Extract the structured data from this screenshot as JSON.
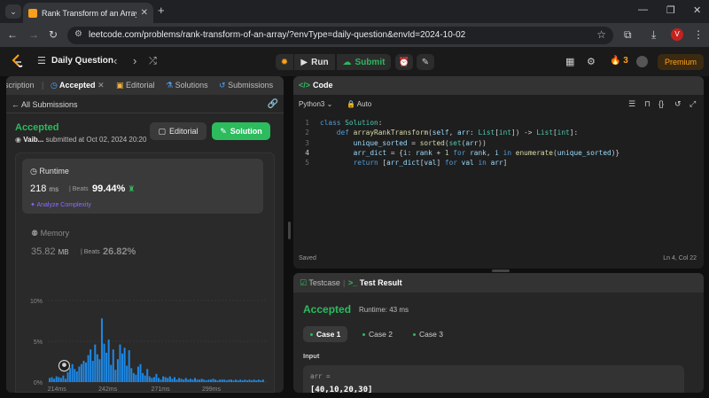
{
  "browser": {
    "tab_title": "Rank Transform of an Array - Le",
    "url": "leetcode.com/problems/rank-transform-of-an-array/?envType=daily-question&envId=2024-10-02",
    "profile_initial": "V"
  },
  "nav": {
    "daily_label": "Daily Question",
    "run_label": "Run",
    "submit_label": "Submit",
    "streak": "3",
    "premium_label": "Premium"
  },
  "left_panel": {
    "tabs": [
      "scription",
      "Accepted",
      "Editorial",
      "Solutions",
      "Submissions"
    ],
    "all_submissions": "All Submissions",
    "status": "Accepted",
    "user": "Vaib...",
    "submitted": "submitted at Oct 02, 2024 20:20",
    "editorial_btn": "Editorial",
    "solution_btn": "Solution",
    "runtime": {
      "label": "Runtime",
      "value": "218",
      "unit": "ms",
      "beats_label": "Beats",
      "beats_value": "99.44%",
      "analyze": "Analyze Complexity"
    },
    "memory": {
      "label": "Memory",
      "value": "35.82",
      "unit": "MB",
      "beats_label": "Beats",
      "beats_value": "26.82%"
    }
  },
  "chart_data": {
    "type": "bar",
    "y_ticks": [
      "10%",
      "5%",
      "0%"
    ],
    "ylim": [
      0,
      10
    ],
    "x_ticks": [
      "214ms",
      "242ms",
      "271ms",
      "299ms"
    ],
    "x_tick_values": [
      214,
      242,
      271,
      299
    ],
    "xlim": [
      209,
      330
    ],
    "x_start": 210,
    "x_step": 1.25,
    "marker_x": 218,
    "values": [
      0.5,
      0.6,
      0.4,
      0.7,
      0.6,
      0.5,
      0.8,
      0.4,
      1.2,
      1.7,
      2.2,
      1.6,
      1.3,
      1.9,
      2.2,
      2.6,
      2.4,
      3.3,
      4.0,
      2.6,
      4.6,
      3.4,
      2.8,
      7.8,
      4.7,
      3.6,
      5.2,
      2.1,
      4.0,
      1.5,
      2.8,
      4.6,
      3.5,
      4.2,
      2.0,
      3.9,
      1.7,
      1.1,
      0.9,
      1.9,
      2.2,
      1.1,
      0.8,
      1.6,
      0.7,
      0.5,
      0.6,
      1.0,
      0.5,
      0.3,
      0.7,
      0.6,
      0.5,
      0.7,
      0.4,
      0.6,
      0.3,
      0.5,
      0.4,
      0.3,
      0.5,
      0.3,
      0.4,
      0.3,
      0.5,
      0.3,
      0.3,
      0.4,
      0.3,
      0.2,
      0.3,
      0.3,
      0.4,
      0.3,
      0.2,
      0.3,
      0.3,
      0.3,
      0.2,
      0.3,
      0.3,
      0.2,
      0.3,
      0.2,
      0.3,
      0.2,
      0.3,
      0.2,
      0.3,
      0.2,
      0.3,
      0.2,
      0.3,
      0.2,
      0.3
    ]
  },
  "code_panel": {
    "title": "Code",
    "language": "Python3",
    "mode": "Auto",
    "lines": [
      "class Solution:",
      "    def arrayRankTransform(self, arr: List[int]) -> List[int]:",
      "        unique_sorted = sorted(set(arr))",
      "        arr_dict = {i: rank + 1 for rank, i in enumerate(unique_sorted)}",
      "        return [arr_dict[val] for val in arr]"
    ],
    "line_numbers": [
      "1",
      "2",
      "3",
      "4",
      "5"
    ],
    "saved": "Saved",
    "cursor": "Ln 4, Col 22"
  },
  "test_panel": {
    "tabs": [
      "Testcase",
      "Test Result"
    ],
    "status": "Accepted",
    "runtime": "Runtime: 43 ms",
    "cases": [
      "Case 1",
      "Case 2",
      "Case 3"
    ],
    "input_label": "Input",
    "var_name": "arr =",
    "var_value": "[40,10,20,30]"
  },
  "colors": {
    "accepted": "#2cbb5d",
    "brand_orange": "#ffa116",
    "bar": "#1e88e5",
    "analyze": "#8c6cff"
  }
}
